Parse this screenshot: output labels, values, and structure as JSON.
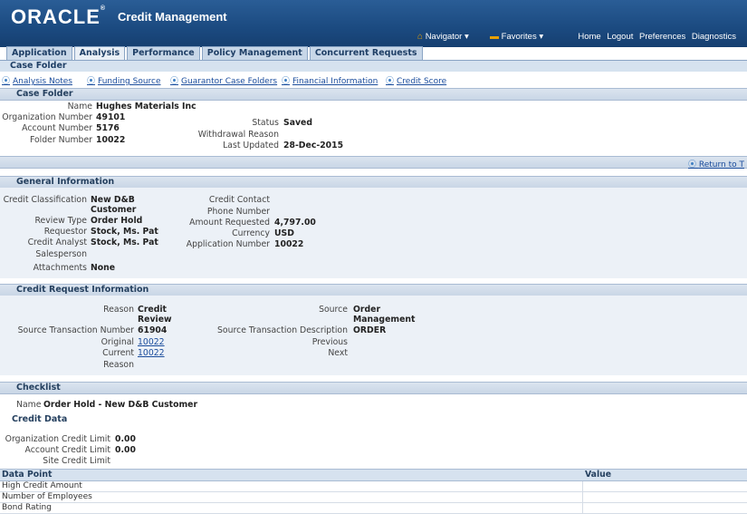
{
  "header": {
    "logo": "ORACLE",
    "app_title": "Credit Management",
    "navigator": "Navigator",
    "favorites": "Favorites",
    "links": [
      "Home",
      "Logout",
      "Preferences",
      "Diagnostics"
    ]
  },
  "tabs": [
    {
      "label": "Application",
      "active": false
    },
    {
      "label": "Analysis",
      "active": true
    },
    {
      "label": "Performance",
      "active": false
    },
    {
      "label": "Policy Management",
      "active": false
    },
    {
      "label": "Concurrent Requests",
      "active": false
    }
  ],
  "subtab": "Case Folder",
  "sublinks": [
    "Analysis Notes",
    "Funding Source",
    "Guarantor Case Folders",
    "Financial Information",
    "Credit Score"
  ],
  "case_folder": {
    "title": "Case Folder",
    "name_label": "Name",
    "name": "Hughes Materials Inc",
    "org_label": "Organization Number",
    "org": "49101",
    "acct_label": "Account Number",
    "acct": "5176",
    "folder_label": "Folder Number",
    "folder": "10022",
    "status_label": "Status",
    "status": "Saved",
    "withdrawal_label": "Withdrawal Reason",
    "updated_label": "Last Updated",
    "updated": "28-Dec-2015"
  },
  "return_top": "Return to T",
  "general": {
    "title": "General Information",
    "class_label": "Credit Classification",
    "class_l1": "New D&B",
    "class_l2": "Customer",
    "review_label": "Review Type",
    "review": "Order Hold",
    "requestor_label": "Requestor",
    "requestor": "Stock, Ms. Pat",
    "analyst_label": "Credit Analyst",
    "analyst": "Stock, Ms. Pat",
    "sales_label": "Salesperson",
    "attach_label": "Attachments",
    "attach": "None",
    "contact_label": "Credit Contact",
    "phone_label": "Phone Number",
    "amount_label": "Amount Requested",
    "amount": "4,797.00",
    "currency_label": "Currency",
    "currency": "USD",
    "appnum_label": "Application Number",
    "appnum": "10022"
  },
  "credit_request": {
    "title": "Credit Request Information",
    "reason_label": "Reason",
    "reason_l1": "Credit",
    "reason_l2": "Review",
    "src_txn_label": "Source Transaction Number",
    "src_txn": "61904",
    "original_label": "Original",
    "original": "10022",
    "current_label": "Current",
    "current": "10022",
    "reason2_label": "Reason",
    "source_label": "Source",
    "source_l1": "Order",
    "source_l2": "Management",
    "src_desc_label": "Source Transaction Description",
    "src_desc": "ORDER",
    "previous_label": "Previous",
    "next_label": "Next"
  },
  "checklist": {
    "title": "Checklist",
    "name_label": "Name",
    "name": "Order Hold - New D&B Customer"
  },
  "credit_data": {
    "title": "Credit Data",
    "org_limit_label": "Organization Credit Limit",
    "org_limit": "0.00",
    "acct_limit_label": "Account Credit Limit",
    "acct_limit": "0.00",
    "site_limit_label": "Site Credit Limit"
  },
  "data_table": {
    "headers": [
      "Data Point",
      "Value"
    ],
    "rows": [
      "High Credit Amount",
      "Number of Employees",
      "Bond Rating"
    ]
  }
}
